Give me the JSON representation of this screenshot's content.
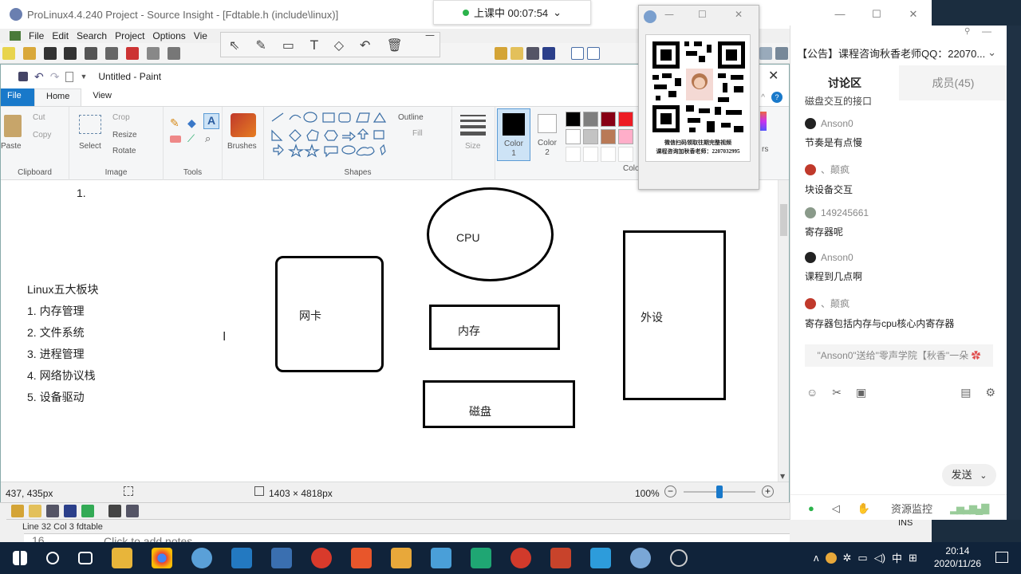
{
  "source_insight": {
    "title": "ProLinux4.4.240 Project - Source Insight - [Fdtable.h (include\\linux)]",
    "menu": [
      "File",
      "Edit",
      "Search",
      "Project",
      "Options",
      "Vie"
    ],
    "status_position": "Line 32  Col 3   fdtable",
    "status_ins": "INS",
    "notes_line": "16",
    "notes_placeholder": "Click to add notes"
  },
  "recording": {
    "label": "上课中 00:07:54",
    "chevron": "⌄"
  },
  "paint": {
    "title": "Untitled - Paint",
    "tabs": {
      "file": "File",
      "home": "Home",
      "view": "View"
    },
    "ribbon": {
      "paste": "Paste",
      "cut": "Cut",
      "copy": "Copy",
      "clipboard": "Clipboard",
      "crop": "Crop",
      "resize": "Resize",
      "rotate": "Rotate",
      "select": "Select",
      "image": "Image",
      "tools": "Tools",
      "brushes": "Brushes",
      "shapes": "Shapes",
      "outline": "Outline",
      "fill": "Fill",
      "size": "Size",
      "color1": "Color",
      "color1_num": "1",
      "color2": "Color",
      "color2_num": "2",
      "colors_group": "Colo",
      "cut_off_label": "rs",
      "palette": [
        "#000000",
        "#7f7f7f",
        "#880015",
        "#ed1c24",
        "#ffffff",
        "#c3c3c3",
        "#b97a57",
        "#ffaec9"
      ]
    },
    "canvas": {
      "list_marker": "1.",
      "list_title": "Linux五大板块",
      "list_items": [
        "1. 内存管理",
        "2. 文件系统",
        "3. 进程管理",
        "4. 网络协议栈",
        "5. 设备驱动"
      ],
      "shapes": {
        "cpu": "CPU",
        "nic": "网卡",
        "memory": "内存",
        "peripheral": "外设",
        "disk": "磁盘"
      }
    },
    "status": {
      "cursor": "437, 435px",
      "size": "1403 × 4818px",
      "zoom": "100%",
      "zoom_out": "−",
      "zoom_in": "+",
      "zoom_level": 0.5
    }
  },
  "qr_window": {
    "caption_line1": "微信扫码领取往期完整视频",
    "caption_line2": "课程咨询加秋香老师：2207032995"
  },
  "chat": {
    "announcement": "【公告】课程咨询秋香老师QQ：22070...",
    "tab_discussion": "讨论区",
    "tab_members": "成员(45)",
    "top_partial": "磁盘交互的接口",
    "messages": [
      {
        "name": "Anson0",
        "text": "节奏是有点慢"
      },
      {
        "name": "、颠疯",
        "text": "块设备交互"
      },
      {
        "name": "149245661",
        "text": "寄存器呢"
      },
      {
        "name": "Anson0",
        "text": "课程到几点啊"
      },
      {
        "name": "、颠疯",
        "text": "寄存器包括内存与cpu核心内寄存器"
      }
    ],
    "gift": "\"Anson0\"送给\"零声学院【秋香\"一朵",
    "send": "发送",
    "send_menu": "⌄",
    "resource_monitor": "资源监控"
  },
  "taskbar": {
    "time": "20:14",
    "date": "2020/11/26",
    "ime": "中",
    "tray_a": "ʌ"
  },
  "colors": {
    "paint_file_tab": "#1979ca",
    "taskbar": "#10233a",
    "record_dot": "#2bb34b",
    "chat_tab_active": "#ffffff"
  }
}
